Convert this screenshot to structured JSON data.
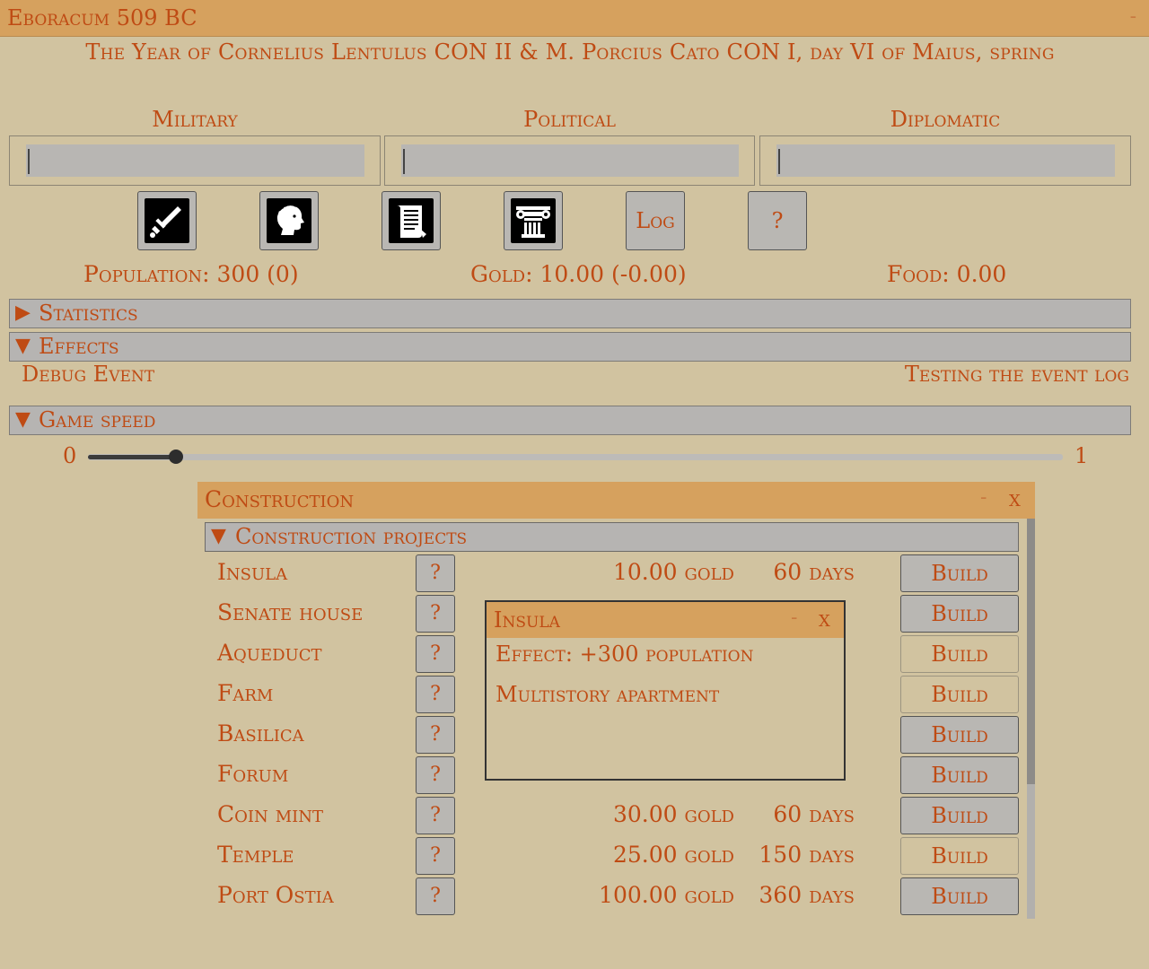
{
  "window": {
    "title": "Eboracum 509 BC",
    "minimize_label": "-"
  },
  "year_line": "The Year of Cornelius Lentulus CON II & M. Porcius Cato CON I, day VI of Maius, spring",
  "bars": [
    {
      "label": "Military",
      "value": ""
    },
    {
      "label": "Political",
      "value": ""
    },
    {
      "label": "Diplomatic",
      "value": ""
    }
  ],
  "buttons": {
    "military_icon": "sword-icon",
    "political_icon": "laurel-head-icon",
    "diplomatic_icon": "scroll-icon",
    "construction_icon": "column-icon",
    "log_label": "Log",
    "help_label": "?"
  },
  "stats": {
    "population": "Population: 300 (0)",
    "gold": "Gold: 10.00 (-0.00)",
    "food": "Food: 0.00"
  },
  "sections": {
    "statistics": {
      "arrow": "▶",
      "label": "Statistics"
    },
    "effects": {
      "arrow": "▼",
      "label": "Effects"
    },
    "game_speed": {
      "arrow": "▼",
      "label": "Game speed"
    }
  },
  "effects": [
    {
      "name": "Debug Event",
      "description": "Testing the event log"
    }
  ],
  "game_speed": {
    "min_label": "0",
    "max_label": "1",
    "value": 0.09
  },
  "construction": {
    "title": "Construction",
    "minimize_label": "-",
    "close_label": "x",
    "section_arrow": "▼",
    "section_label": "Construction projects",
    "info_label": "?",
    "build_label": "Build",
    "projects": [
      {
        "name": "Insula",
        "cost": "10.00 gold",
        "days": "60 days"
      },
      {
        "name": "Senate house",
        "cost": "",
        "days": ""
      },
      {
        "name": "Aqueduct",
        "cost": "",
        "days": ""
      },
      {
        "name": "Farm",
        "cost": "",
        "days": ""
      },
      {
        "name": "Basilica",
        "cost": "",
        "days": ""
      },
      {
        "name": "Forum",
        "cost": "",
        "days": ""
      },
      {
        "name": "Coin mint",
        "cost": "30.00 gold",
        "days": "60 days"
      },
      {
        "name": "Temple",
        "cost": "25.00 gold",
        "days": "150 days"
      },
      {
        "name": "Port Ostia",
        "cost": "100.00 gold",
        "days": "360 days"
      }
    ]
  },
  "tooltip": {
    "title": "Insula",
    "minimize_label": "-",
    "close_label": "x",
    "lines": [
      "Effect: +300 population",
      "Multistory apartment"
    ]
  },
  "colors": {
    "background": "#d1c3a0",
    "titlebar": "#d6a15e",
    "text": "#bf4b14",
    "panel_gray": "#b6b4b2"
  }
}
